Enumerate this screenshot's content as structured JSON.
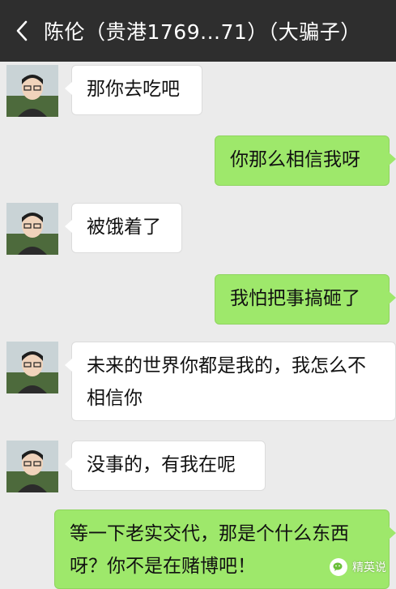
{
  "header": {
    "title": "陈伦（贵港1769...71）（大骗子）",
    "back_icon": "chevron-left-icon"
  },
  "messages": [
    {
      "side": "left",
      "text": "那你去吃吧"
    },
    {
      "side": "right",
      "text": "你那么相信我呀"
    },
    {
      "side": "left",
      "text": "被饿着了"
    },
    {
      "side": "right",
      "text": "我怕把事搞砸了"
    },
    {
      "side": "left",
      "text": "未来的世界你都是我的，我怎么不相信你"
    },
    {
      "side": "left",
      "text": "没事的，有我在呢"
    },
    {
      "side": "right",
      "text": "等一下老实交代，那是个什么东西呀？你不是在赌博吧！"
    }
  ],
  "watermark": {
    "text": "精英说",
    "icon": "wechat-official-account-icon"
  },
  "colors": {
    "topbar": "#2e2e2e",
    "chat_bg": "#ebebeb",
    "green_bubble": "#9ee86b",
    "white_bubble": "#ffffff"
  }
}
